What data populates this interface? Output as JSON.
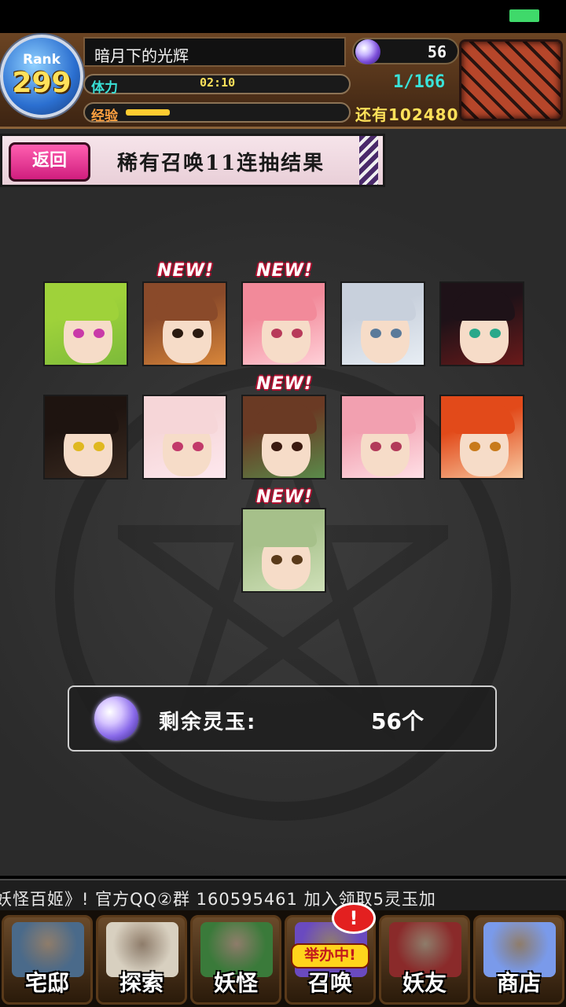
{
  "header": {
    "rank_label": "Rank",
    "rank_value": "299",
    "player_name": "暗月下的光辉",
    "stamina_label": "体力",
    "stamina_timer": "02:10",
    "stamina_count": "1/166",
    "exp_label": "经验",
    "exp_progress": 0.2,
    "gem_count": "56",
    "exp_remaining": "还有102480"
  },
  "banner": {
    "back_label": "返回",
    "title": "稀有召唤11连抽结果"
  },
  "cards": [
    {
      "hair": "#9fd23a",
      "bg": "#7cba3a",
      "eye": "#c93aa8",
      "is_new": false
    },
    {
      "hair": "#8a4a2a",
      "bg": "#d8863a",
      "eye": "#2a1a10",
      "is_new": true
    },
    {
      "hair": "#f28a9a",
      "bg": "#ffd0d8",
      "eye": "#b83a5a",
      "is_new": true
    },
    {
      "hair": "#c8d0dc",
      "bg": "#e8eef4",
      "eye": "#5a7a9a",
      "is_new": false
    },
    {
      "hair": "#1e1218",
      "bg": "#6a1a1a",
      "eye": "#2aa88a",
      "is_new": false
    },
    {
      "hair": "#1e1410",
      "bg": "#3a2a20",
      "eye": "#e0b820",
      "is_new": false
    },
    {
      "hair": "#f6d6d8",
      "bg": "#fde8ee",
      "eye": "#c23a6a",
      "is_new": false
    },
    {
      "hair": "#6a3a24",
      "bg": "#5a8a4a",
      "eye": "#3a1a10",
      "is_new": true
    },
    {
      "hair": "#f2a0b0",
      "bg": "#ffe0e6",
      "eye": "#b23a5a",
      "is_new": false
    },
    {
      "hair": "#e24a1a",
      "bg": "#f8c8a0",
      "eye": "#c87a1a",
      "is_new": false
    },
    {
      "hair": "#a6c08a",
      "bg": "#cfe0b8",
      "eye": "#5a3a1a",
      "is_new": true
    }
  ],
  "new_tag": "NEW!",
  "remaining": {
    "label": "剩余灵玉:",
    "value": "56个"
  },
  "ticker": {
    "text": "妖怪百姬》! 官方QQ②群 160595461  加入领取5灵玉加"
  },
  "nav": [
    {
      "label": "宅邸",
      "icon": "mansion-icon",
      "art": "#4a6a8a"
    },
    {
      "label": "探索",
      "icon": "magnifier-icon",
      "art": "#d8d0c0"
    },
    {
      "label": "妖怪",
      "icon": "scroll-icon",
      "art": "#3a7a3a"
    },
    {
      "label": "召唤",
      "icon": "pentagram-icon",
      "art": "#6a4ac0"
    },
    {
      "label": "妖友",
      "icon": "fox-girl-icon",
      "art": "#8a2a2a"
    },
    {
      "label": "商店",
      "icon": "crystal-orb-icon",
      "art": "#7a9aea"
    }
  ],
  "event": {
    "badge": "!",
    "label": "举办中!"
  }
}
